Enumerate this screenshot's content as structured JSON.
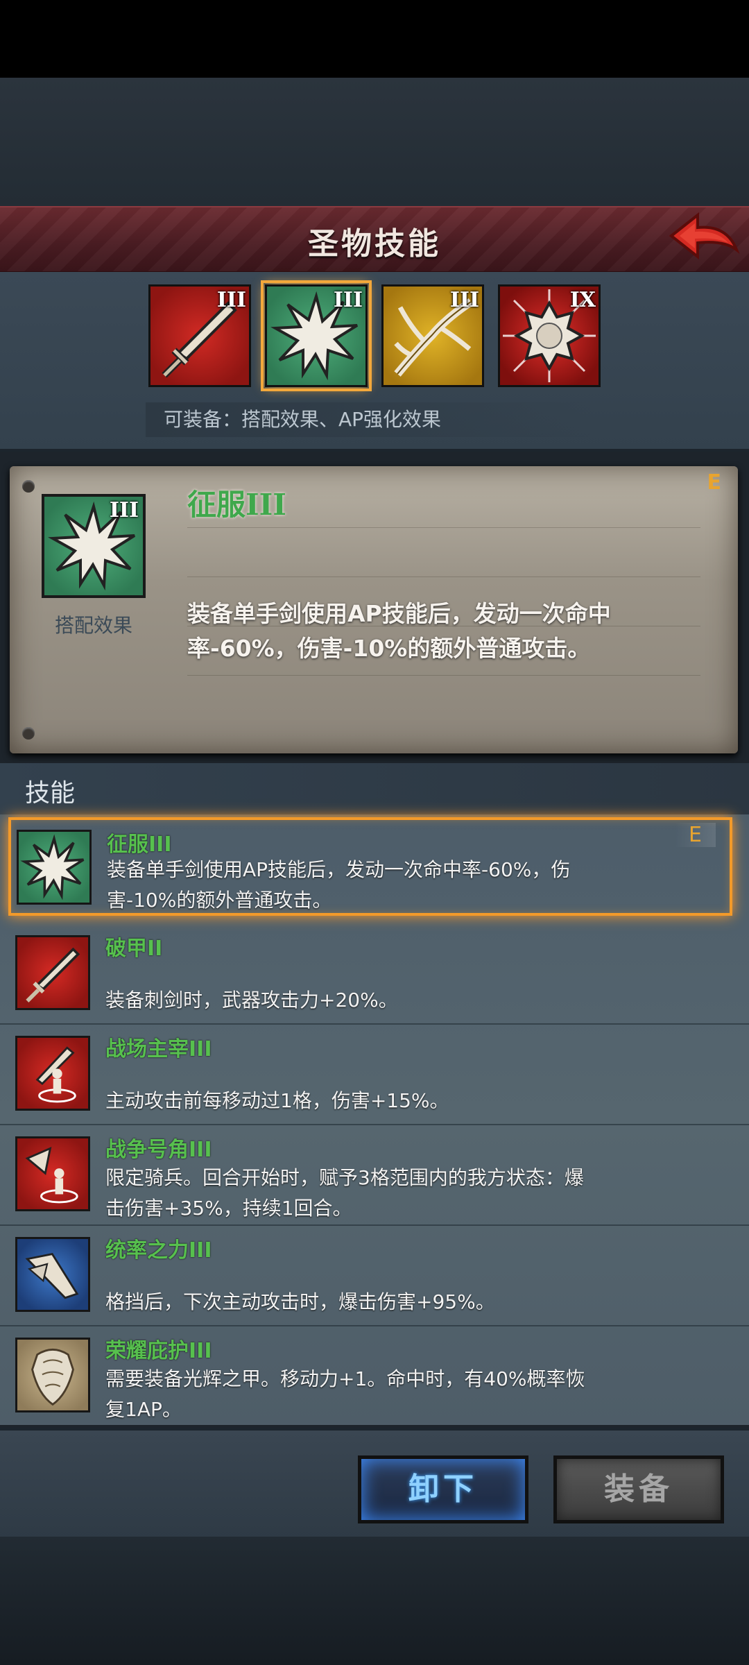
{
  "header": {
    "title": "圣物技能"
  },
  "relics": [
    {
      "name": "sword-relic",
      "grade": "III",
      "color": "#c1201c"
    },
    {
      "name": "conquer-relic",
      "grade": "III",
      "color": "#3d9466",
      "selected": true
    },
    {
      "name": "branch-relic",
      "grade": "III",
      "color": "#d2a11f"
    },
    {
      "name": "sun-relic",
      "grade": "IX",
      "color": "#c81d1b"
    }
  ],
  "equip_note": "可装备：搭配效果、AP强化效果",
  "detail": {
    "name": "征服III",
    "grade": "E",
    "icon_grade": "III",
    "caption": "搭配效果",
    "description": "装备单手剑使用AP技能后，发动一次命中率-60%，伤害-10%的额外普通攻击。"
  },
  "skills_label": "技能",
  "skills": [
    {
      "name": "征服III",
      "desc": "装备单手剑使用AP技能后，发动一次命中率-60%，伤害-10%的额外普通攻击。",
      "grade": "E",
      "selected": true,
      "icon": "burst-icon"
    },
    {
      "name": "破甲II",
      "desc": "装备刺剑时，武器攻击力+20%。",
      "grade": "",
      "icon": "sword-icon"
    },
    {
      "name": "战场主宰III",
      "desc": "主动攻击前每移动过1格，伤害+15%。",
      "grade": "",
      "icon": "battlefield-icon"
    },
    {
      "name": "战争号角III",
      "desc": "限定骑兵。回合开始时，赋予3格范围内的我方状态：爆击伤害+35%，持续1回合。",
      "grade": "",
      "icon": "war-horn-icon"
    },
    {
      "name": "统率之力III",
      "desc": "格挡后，下次主动攻击时，爆击伤害+95%。",
      "grade": "",
      "icon": "command-icon"
    },
    {
      "name": "荣耀庇护III",
      "desc": "需要装备光辉之甲。移动力+1。命中时，有40%概率恢复1AP。",
      "grade": "",
      "icon": "armor-icon"
    }
  ],
  "buttons": {
    "unequip": "卸下",
    "equip": "装备"
  },
  "colors": {
    "accent_orange": "#f39a2a",
    "skill_name_green": "#57c04e",
    "header_red": "#5a2228"
  }
}
